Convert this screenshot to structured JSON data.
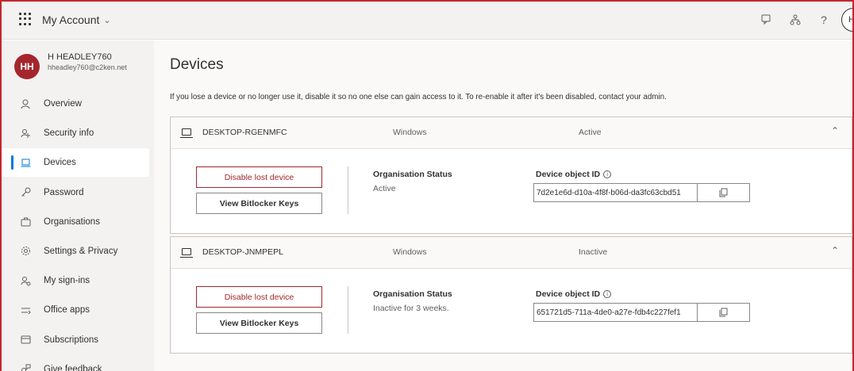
{
  "header": {
    "app_title": "My Account",
    "user_initial": "H"
  },
  "profile": {
    "initials": "HH",
    "name": "H HEADLEY760",
    "email": "hheadley760@c2ken.net"
  },
  "sidebar": {
    "items": [
      {
        "label": "Overview",
        "icon": "person-icon"
      },
      {
        "label": "Security info",
        "icon": "security-info-icon"
      },
      {
        "label": "Devices",
        "icon": "laptop-icon",
        "active": true
      },
      {
        "label": "Password",
        "icon": "key-icon"
      },
      {
        "label": "Organisations",
        "icon": "briefcase-icon"
      },
      {
        "label": "Settings & Privacy",
        "icon": "gear-icon"
      },
      {
        "label": "My sign-ins",
        "icon": "sign-ins-icon"
      },
      {
        "label": "Office apps",
        "icon": "office-apps-icon"
      },
      {
        "label": "Subscriptions",
        "icon": "subscriptions-icon"
      },
      {
        "label": "Give feedback",
        "icon": "feedback-icon"
      }
    ]
  },
  "main": {
    "title": "Devices",
    "description": "If you lose a device or no longer use it, disable it so no one else can gain access to it. To re-enable it after it's been disabled, contact your admin.",
    "devices": [
      {
        "name": "DESKTOP-RGENMFC",
        "os": "Windows",
        "state": "Active",
        "disable_label": "Disable lost device",
        "bitlocker_label": "View Bitlocker Keys",
        "org_status_label": "Organisation Status",
        "org_status": "Active",
        "object_id_label": "Device object ID",
        "object_id": "7d2e1e6d-d10a-4f8f-b06d-da3fc63cbd51"
      },
      {
        "name": "DESKTOP-JNMPEPL",
        "os": "Windows",
        "state": "Inactive",
        "disable_label": "Disable lost device",
        "bitlocker_label": "View Bitlocker Keys",
        "org_status_label": "Organisation Status",
        "org_status": "Inactive for 3 weeks.",
        "object_id_label": "Device object ID",
        "object_id": "651721d5-711a-4de0-a27e-fdb4c227fef1"
      }
    ]
  },
  "colors": {
    "accent": "#0078d4",
    "danger": "#a4262c",
    "sidebar_bg": "#f3f2f1"
  }
}
